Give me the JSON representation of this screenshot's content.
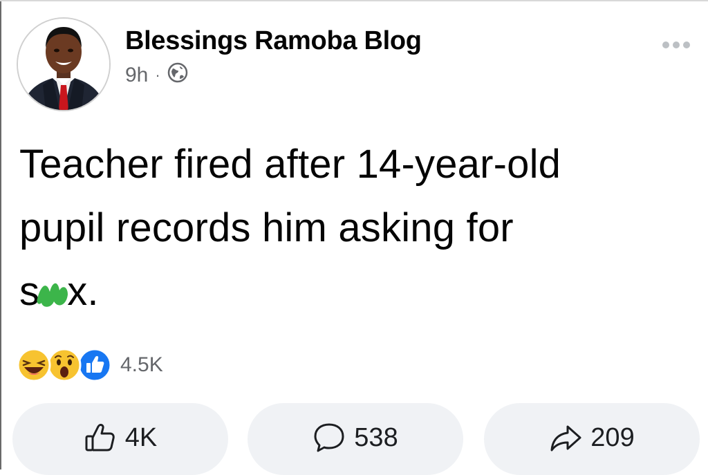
{
  "post": {
    "author": "Blessings Ramoba Blog",
    "time": "9h",
    "separator": "·",
    "privacy_icon": "globe-icon",
    "text_lines": [
      "Teacher fired after 14-year-old",
      "pupil records him asking for"
    ],
    "censored_word_start": "s",
    "censored_word_end": "x.",
    "reactions": {
      "icons": [
        "laughing-emoji-icon",
        "wow-emoji-icon",
        "like-reaction-icon"
      ],
      "count": "4.5K"
    },
    "actions": {
      "like_count": "4K",
      "comment_count": "538",
      "share_count": "209"
    }
  },
  "colors": {
    "like_blue": "#1877f2",
    "secondary_text": "#65676b",
    "button_bg": "#f0f2f5",
    "censor_green": "#3cb54a"
  }
}
